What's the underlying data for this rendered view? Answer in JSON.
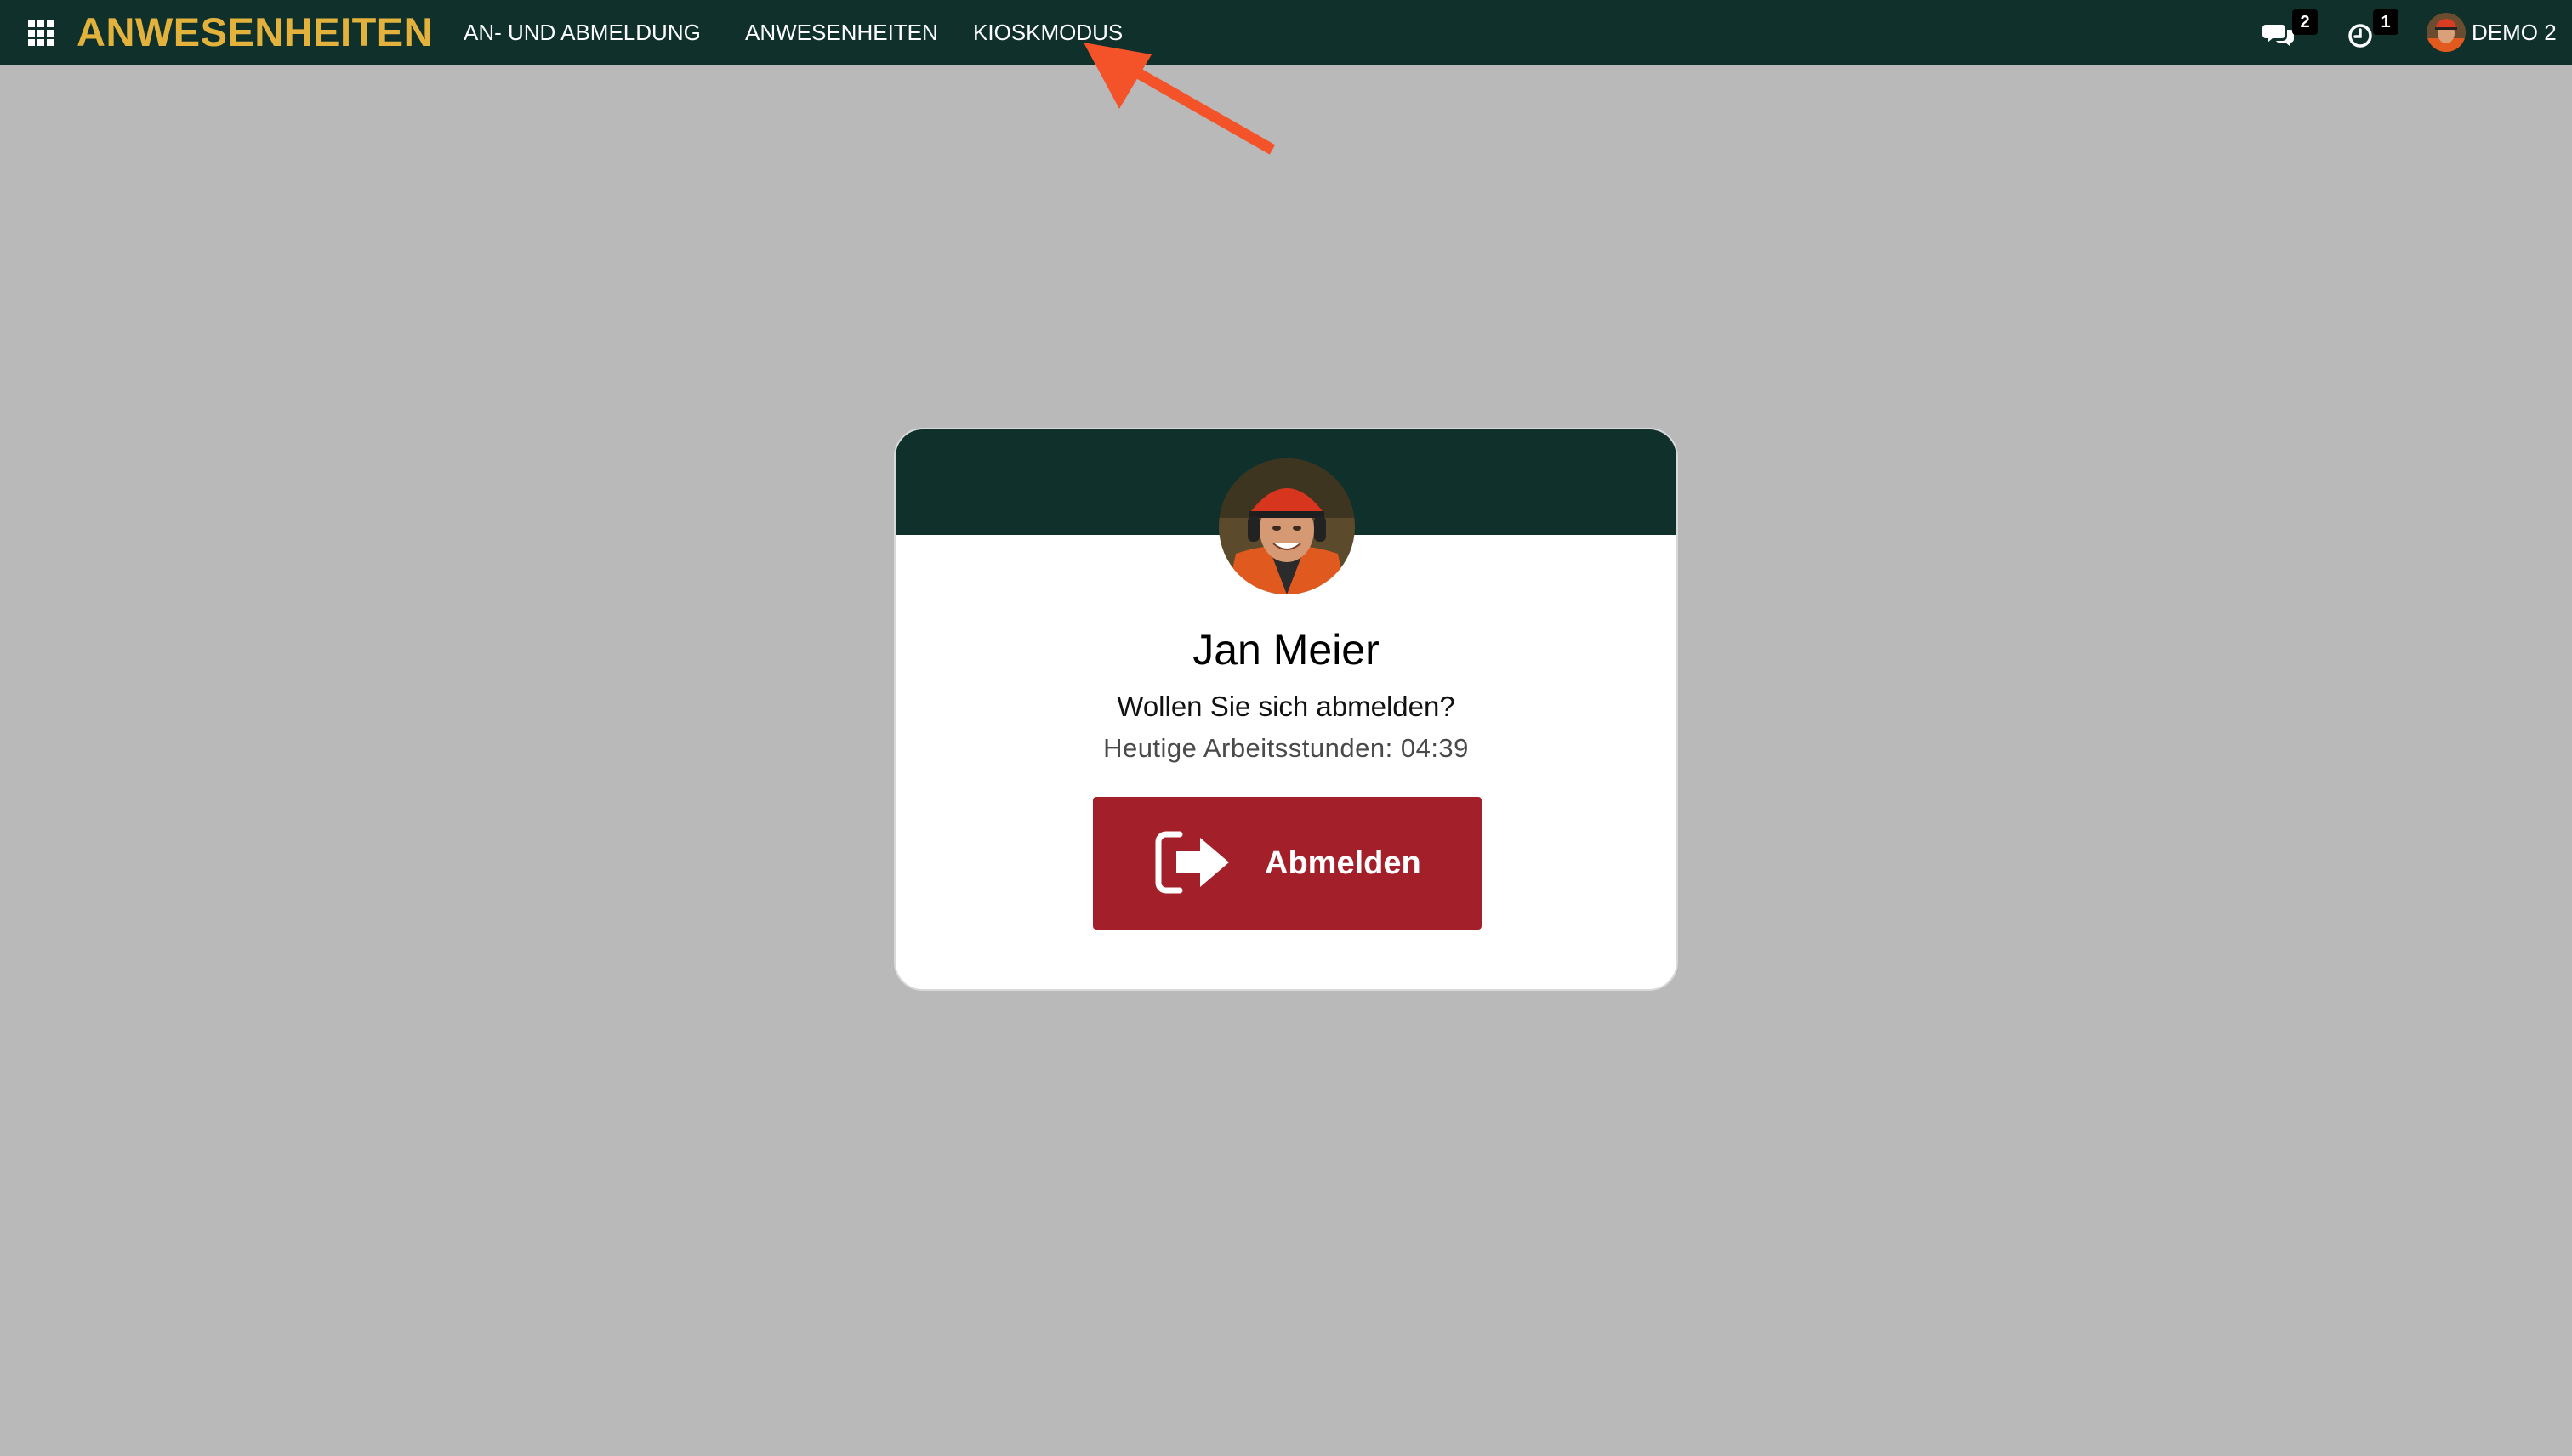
{
  "navbar": {
    "brand": "ANWESENHEITEN",
    "menu_items": [
      {
        "label": "AN- UND ABMELDUNG"
      },
      {
        "label": "ANWESENHEITEN"
      },
      {
        "label": "KIOSKMODUS"
      }
    ],
    "messages_count": "2",
    "activities_count": "1",
    "user_name": "DEMO 2"
  },
  "card": {
    "employee_name": "Jan Meier",
    "question": "Wollen Sie sich abmelden?",
    "hours_text": "Heutige Arbeitsstunden: 04:39",
    "button_label": "Abmelden"
  },
  "colors": {
    "navbar_bg": "#0f302b",
    "brand": "#e2b23c",
    "page_bg": "#b8b9b8",
    "button_bg": "#a3202a",
    "annotation_arrow": "#f4532a"
  },
  "icons": {
    "apps": "apps-grid-icon",
    "messages": "chat-bubbles-icon",
    "activities": "clock-icon",
    "checkout": "sign-out-icon"
  }
}
